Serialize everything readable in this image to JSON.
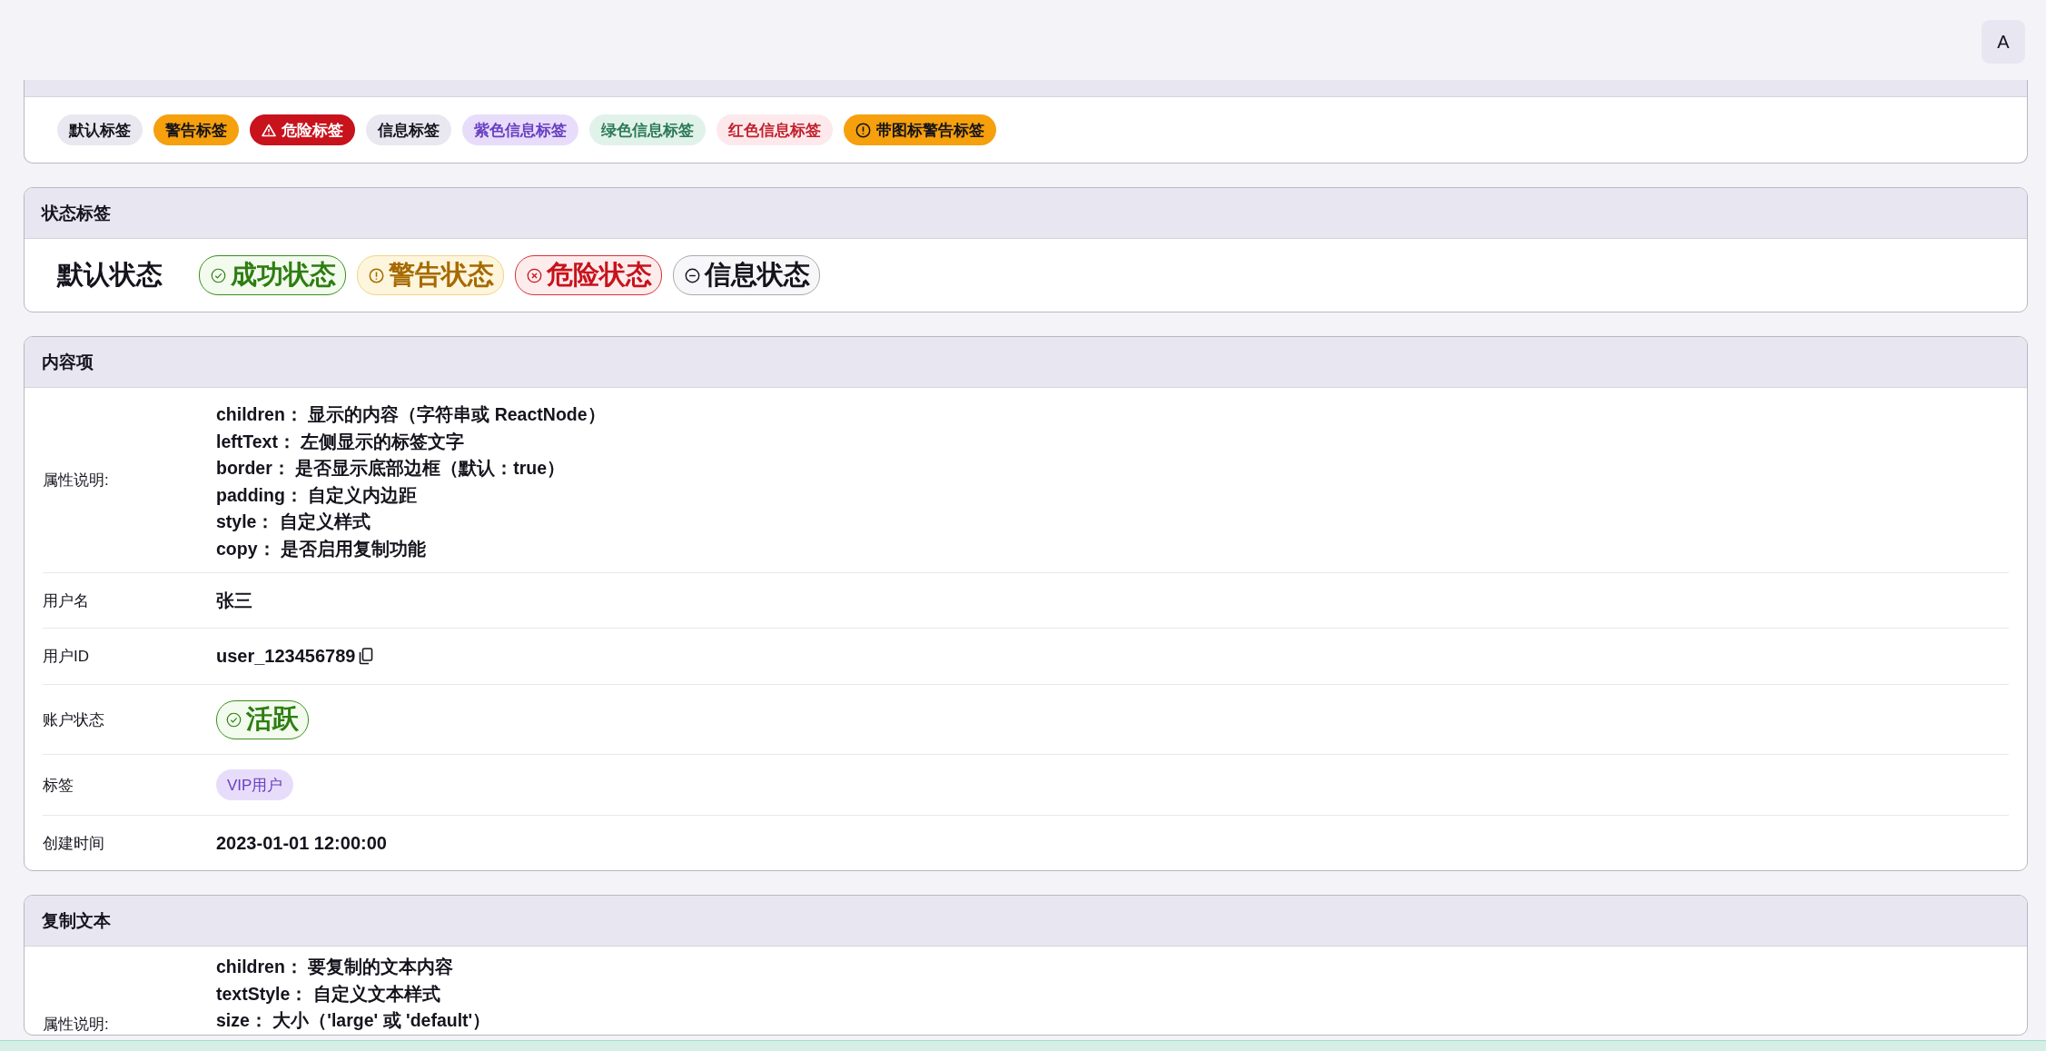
{
  "avatar_button": "A",
  "tag_card": {
    "tags": [
      {
        "label": "默认标签",
        "kind": "default"
      },
      {
        "label": "警告标签",
        "kind": "warning"
      },
      {
        "label": "危险标签",
        "kind": "danger"
      },
      {
        "label": "信息标签",
        "kind": "info"
      },
      {
        "label": "紫色信息标签",
        "kind": "purple"
      },
      {
        "label": "绿色信息标签",
        "kind": "green"
      },
      {
        "label": "红色信息标签",
        "kind": "red"
      },
      {
        "label": "带图标警告标签",
        "kind": "warning_icon"
      }
    ]
  },
  "status_card": {
    "title": "状态标签",
    "default_label": "默认状态",
    "statuses": [
      {
        "label": "成功状态",
        "kind": "success"
      },
      {
        "label": "警告状态",
        "kind": "warning"
      },
      {
        "label": "危险状态",
        "kind": "danger"
      },
      {
        "label": "信息状态",
        "kind": "info"
      }
    ]
  },
  "content_card": {
    "title": "内容项",
    "description_label": "属性说明:",
    "description_lines": [
      "children： 显示的内容（字符串或 ReactNode）",
      "leftText： 左侧显示的标签文字",
      "border： 是否显示底部边框（默认：true）",
      "padding： 自定义内边距",
      "style： 自定义样式",
      "copy： 是否启用复制功能"
    ],
    "rows": [
      {
        "label": "用户名",
        "kind": "text",
        "value": "张三"
      },
      {
        "label": "用户ID",
        "kind": "copy",
        "value": "user_123456789"
      },
      {
        "label": "账户状态",
        "kind": "status",
        "value": "活跃"
      },
      {
        "label": "标签",
        "kind": "tag",
        "value": "VIP用户"
      },
      {
        "label": "创建时间",
        "kind": "text",
        "value": "2023-01-01 12:00:00"
      }
    ]
  },
  "copy_card": {
    "title": "复制文本",
    "description_label": "属性说明:",
    "description_lines": [
      "children： 要复制的文本内容",
      "textStyle： 自定义文本样式",
      "size： 大小（'large' 或 'default'）"
    ]
  }
}
